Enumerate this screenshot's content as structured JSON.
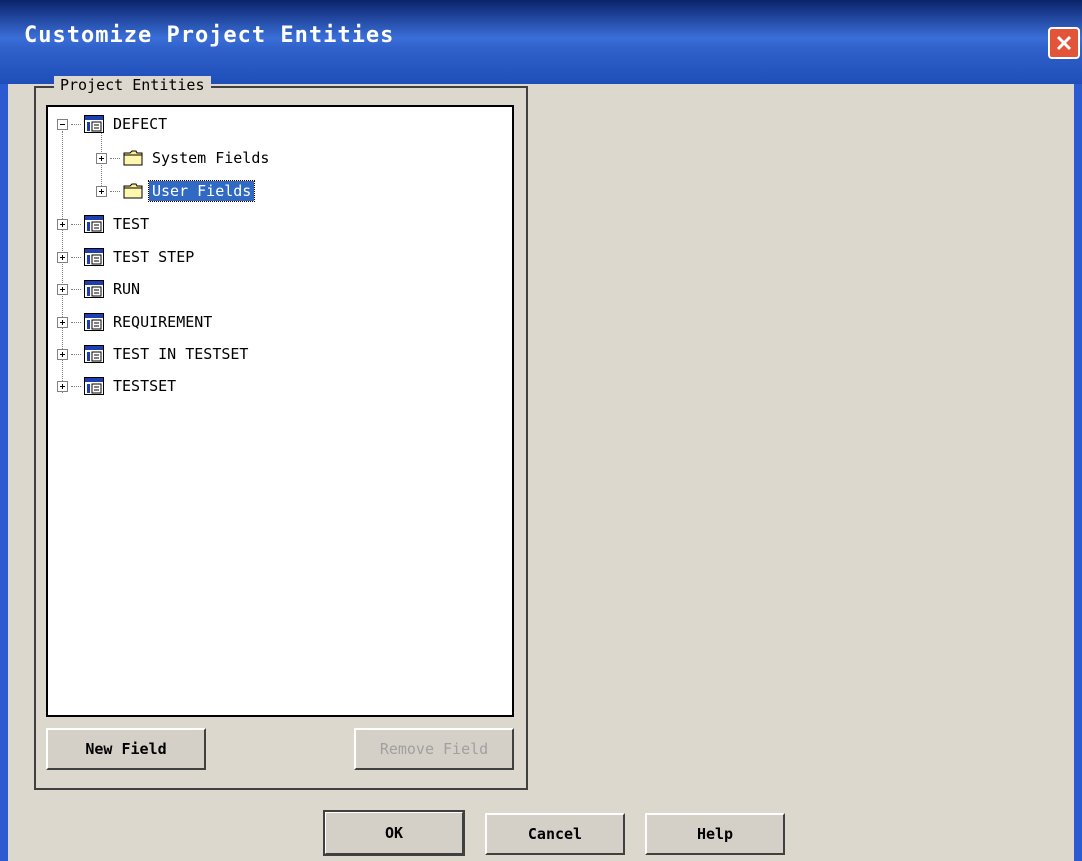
{
  "window": {
    "title": "Customize Project Entities"
  },
  "group": {
    "label": "Project Entities"
  },
  "tree": {
    "defect": {
      "label": "DEFECT",
      "children": {
        "system_fields": "System Fields",
        "user_fields": "User Fields"
      }
    },
    "test": "TEST",
    "test_step": "TEST STEP",
    "run": "RUN",
    "requirement": "REQUIREMENT",
    "test_in_testset": "TEST IN TESTSET",
    "testset": "TESTSET"
  },
  "buttons": {
    "new_field": "New Field",
    "remove_field": "Remove Field",
    "ok": "OK",
    "cancel": "Cancel",
    "help": "Help"
  },
  "selected_node": "User Fields",
  "colors": {
    "selection": "#316ac5",
    "titlebar": "#2f5fc9",
    "close": "#e2553a",
    "dialog_bg": "#ddd8cd"
  }
}
